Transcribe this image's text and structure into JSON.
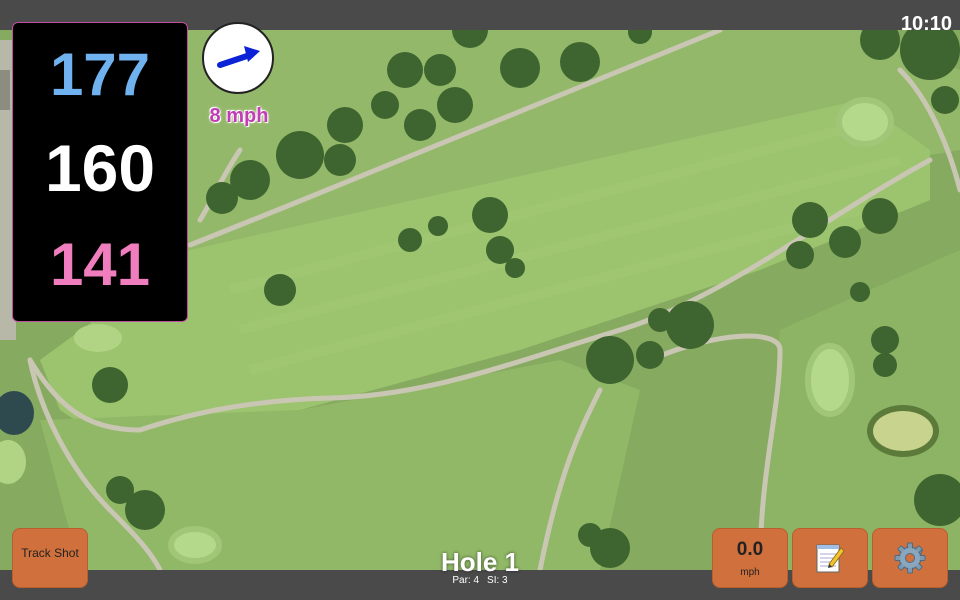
{
  "status": {
    "time": "10:10"
  },
  "yardages": {
    "back": "177",
    "middle": "160",
    "front": "141",
    "back_color": "#6fb2ef",
    "front_color": "#f07dbd"
  },
  "wind": {
    "speed_label": "8 mph",
    "arrow_color": "#0b22d6",
    "icon": "wind-arrow-icon"
  },
  "buttons": {
    "track_shot": "Track Shot",
    "speed_value": "0.0",
    "speed_unit": "mph",
    "notes_icon": "notepad-icon",
    "settings_icon": "gear-icon"
  },
  "hole": {
    "title": "Hole 1",
    "par": "Par: 4",
    "si": "SI: 3"
  },
  "colors": {
    "button_bg": "#d0703c",
    "bar_bg": "#4a4a4a",
    "map_grass": "#7fa55a"
  }
}
